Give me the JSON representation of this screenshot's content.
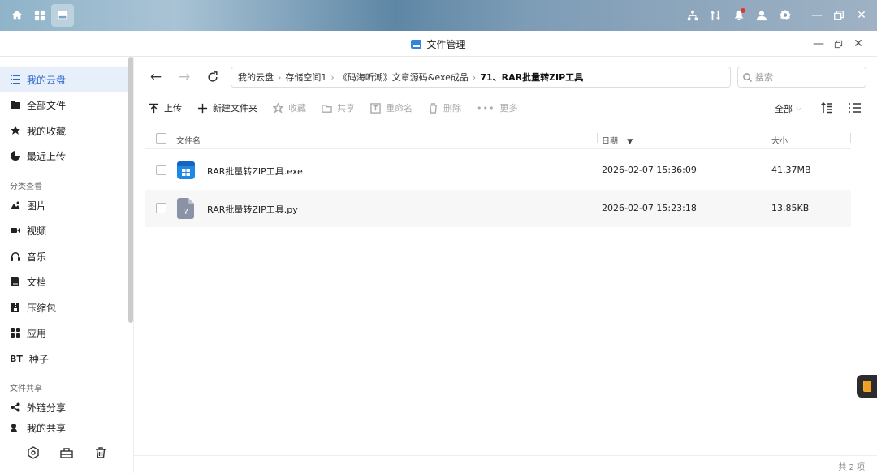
{
  "window": {
    "title": "文件管理"
  },
  "sidebar": {
    "items": [
      {
        "label": "我的云盘",
        "icon": "cloud-drive-icon",
        "active": true
      },
      {
        "label": "全部文件",
        "icon": "folder-icon"
      },
      {
        "label": "我的收藏",
        "icon": "star-icon"
      },
      {
        "label": "最近上传",
        "icon": "clock-icon"
      }
    ],
    "section_category": "分类查看",
    "categories": [
      {
        "label": "图片",
        "icon": "image-icon"
      },
      {
        "label": "视频",
        "icon": "video-icon"
      },
      {
        "label": "音乐",
        "icon": "headphones-icon"
      },
      {
        "label": "文档",
        "icon": "document-icon"
      },
      {
        "label": "压缩包",
        "icon": "archive-icon"
      },
      {
        "label": "应用",
        "icon": "apps-icon"
      },
      {
        "label": "种子",
        "icon": "bt-icon",
        "prefix": "BT"
      }
    ],
    "section_share": "文件共享",
    "share": [
      {
        "label": "外链分享",
        "icon": "share-icon"
      },
      {
        "label": "我的共享",
        "icon": "user-share-icon"
      }
    ]
  },
  "breadcrumb": [
    "我的云盘",
    "存储空间1",
    "《码海听潮》文章源码&exe成品",
    "71、RAR批量转ZIP工具"
  ],
  "search": {
    "placeholder": "搜索"
  },
  "toolbar": {
    "upload": "上传",
    "new_folder": "新建文件夹",
    "favorite": "收藏",
    "share": "共享",
    "rename": "重命名",
    "delete": "删除",
    "more": "更多",
    "filter": "全部"
  },
  "table": {
    "col_name": "文件名",
    "col_date": "日期",
    "col_size": "大小",
    "rows": [
      {
        "name": "RAR批量转ZIP工具.exe",
        "date": "2026-02-07 15:36:09",
        "size": "41.37MB",
        "type": "exe"
      },
      {
        "name": "RAR批量转ZIP工具.py",
        "date": "2026-02-07 15:23:18",
        "size": "13.85KB",
        "type": "unknown"
      }
    ]
  },
  "footer": {
    "count": "共 2 项"
  },
  "colors": {
    "accent": "#2f6bcc",
    "exe_icon": "#1e88e5",
    "unknown_icon": "#8a93a6"
  }
}
